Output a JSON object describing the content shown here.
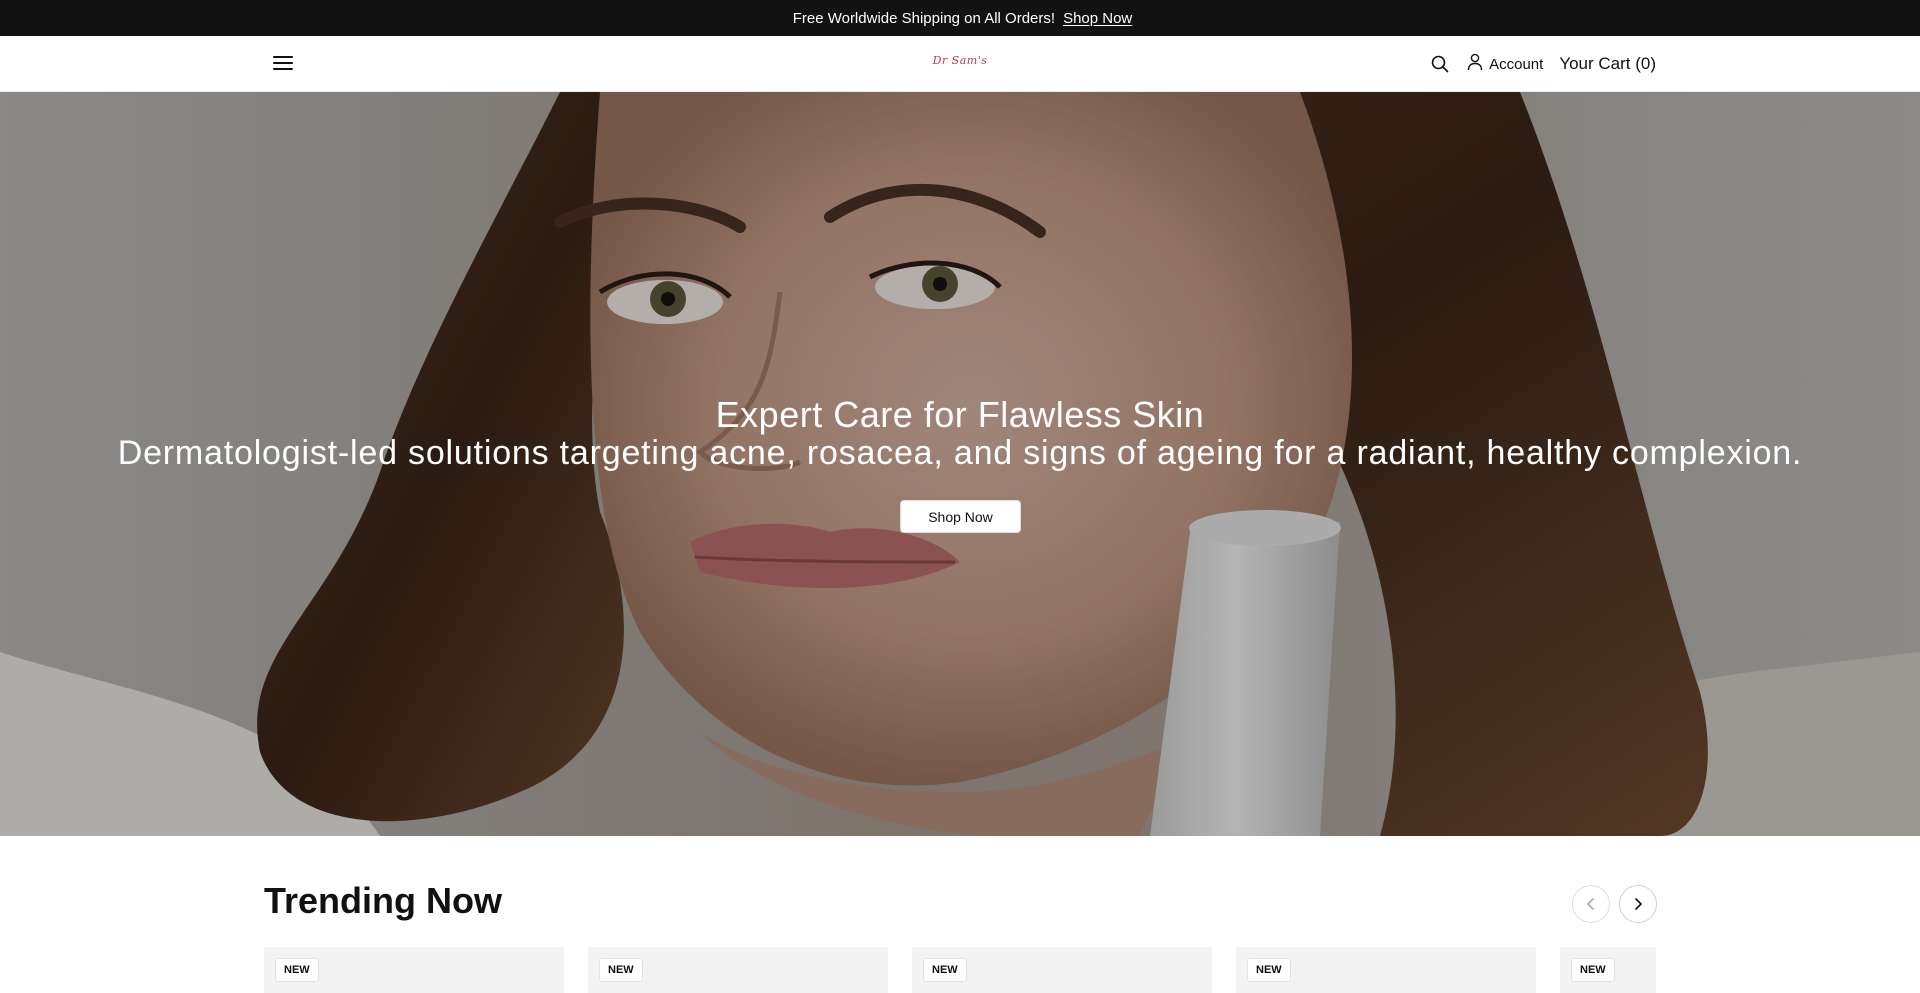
{
  "announcement": {
    "glyph": "",
    "text": "Free Worldwide Shipping on All Orders!",
    "link": "Shop Now",
    "close": ""
  },
  "header": {
    "logo": "Dr Sam's",
    "account_label": "Account",
    "cart_label": "Your Cart (0)"
  },
  "hero": {
    "title": "Expert Care for Flawless Skin",
    "subtitle": "Dermatologist-led solutions targeting acne, rosacea, and signs of ageing for a radiant, healthy complexion.",
    "button": "Shop Now"
  },
  "trending": {
    "title": "Trending Now",
    "cards": [
      {
        "badge": "NEW"
      },
      {
        "badge": "NEW"
      },
      {
        "badge": "NEW"
      },
      {
        "badge": "NEW"
      },
      {
        "badge": "NEW"
      }
    ]
  },
  "icons": {
    "menu": "menu-icon",
    "search": "search-icon",
    "account": "user-icon",
    "prev": "chevron-left-icon",
    "next": "chevron-right-icon"
  },
  "colors": {
    "announcement_bg": "#121212",
    "logo": "#c0394b",
    "text": "#111111"
  }
}
